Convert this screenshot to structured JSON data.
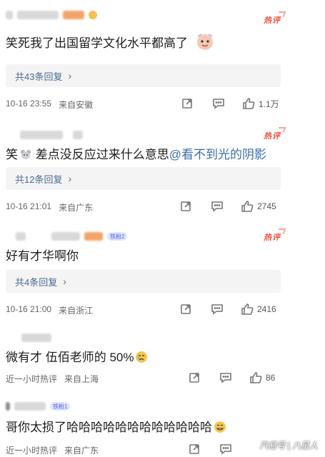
{
  "comments": [
    {
      "text": "笑死我了出国留学文化水平都高了",
      "hot_label": "热评",
      "replies_label": "共43条回复",
      "time": "10-16 23:55",
      "location": "来自安徽",
      "likes": "1.1万"
    },
    {
      "text_prefix": "笑",
      "text_main": " 差点没反应过来什么意思",
      "mention": "@看不到光的阴影",
      "hot_label": "热评",
      "replies_label": "共12条回复",
      "time": "10-16 21:01",
      "location": "来自广东",
      "likes": "2745"
    },
    {
      "text": "好有才华啊你",
      "hot_label": "热评",
      "badge": "铁粉2",
      "replies_label": "共4条回复",
      "time": "10-16 21:00",
      "location": "来自浙江",
      "likes": "2416"
    },
    {
      "text": "微有才 伍佰老师的 50%",
      "time": "近一小时热评",
      "location": "来自上海",
      "likes": "86"
    },
    {
      "text": "哥你太损了哈哈哈哈哈哈哈哈哈哈哈哈",
      "badge": "铁粉1",
      "time": "近一小时热评",
      "location": "来自广东"
    }
  ],
  "watermark": "汽易号 | 八星人",
  "colors": {
    "hot": "#f04d3a",
    "link": "#4b6b94",
    "reply_bg": "#f4f4f4"
  }
}
